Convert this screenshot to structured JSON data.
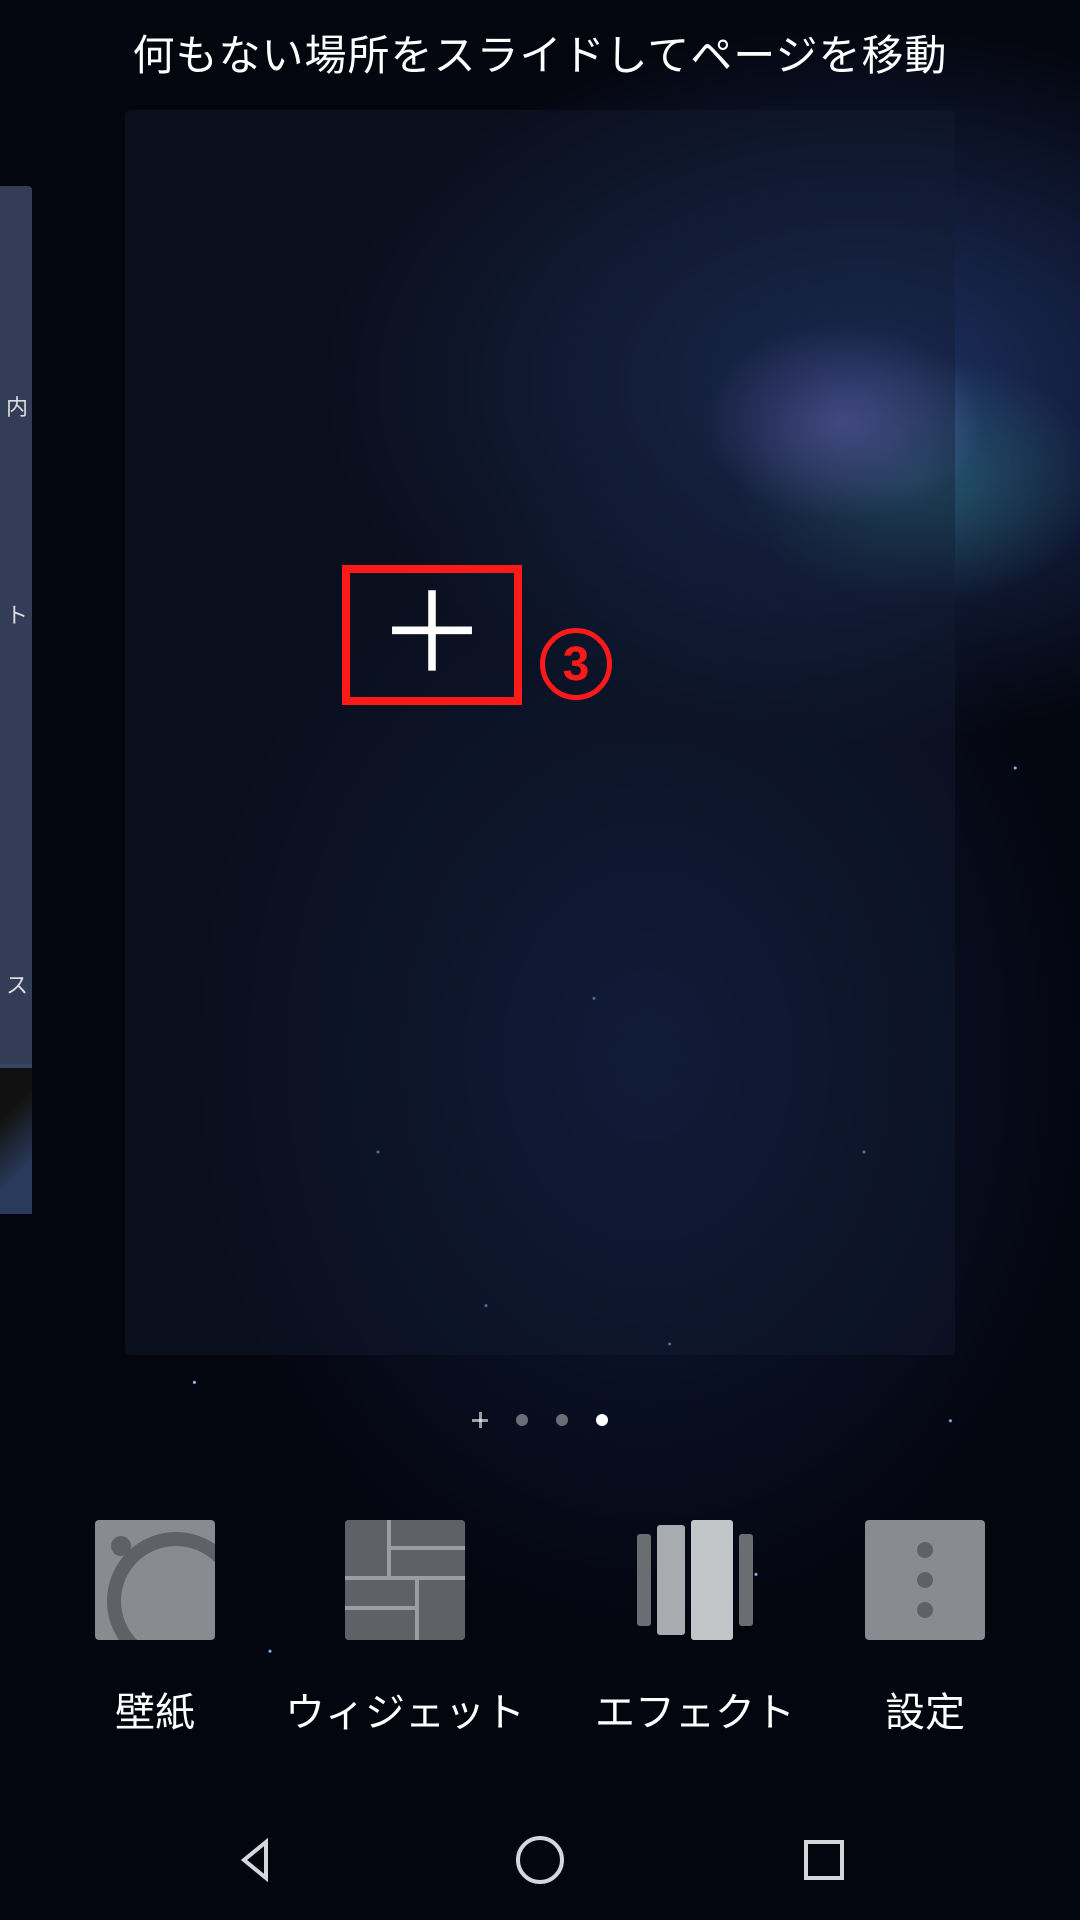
{
  "hint_text": "何もない場所をスライドしてページを移動",
  "callout": {
    "number": "3"
  },
  "prev_page_fragments": [
    "内",
    "ト",
    "ス"
  ],
  "page_indicator": {
    "count": 4,
    "active_index": 3,
    "first_is_plus": true
  },
  "options": [
    {
      "key": "wallpaper",
      "label": "壁紙",
      "icon": "wallpaper-icon"
    },
    {
      "key": "widgets",
      "label": "ウィジェット",
      "icon": "widgets-icon"
    },
    {
      "key": "effects",
      "label": "エフェクト",
      "icon": "effects-icon"
    },
    {
      "key": "settings",
      "label": "設定",
      "icon": "settings-icon"
    }
  ],
  "navbar": {
    "back": "back-icon",
    "home": "home-icon",
    "recent": "recent-icon"
  },
  "add_page": {
    "symbol": "＋",
    "highlight_color": "#ff1a1a"
  }
}
